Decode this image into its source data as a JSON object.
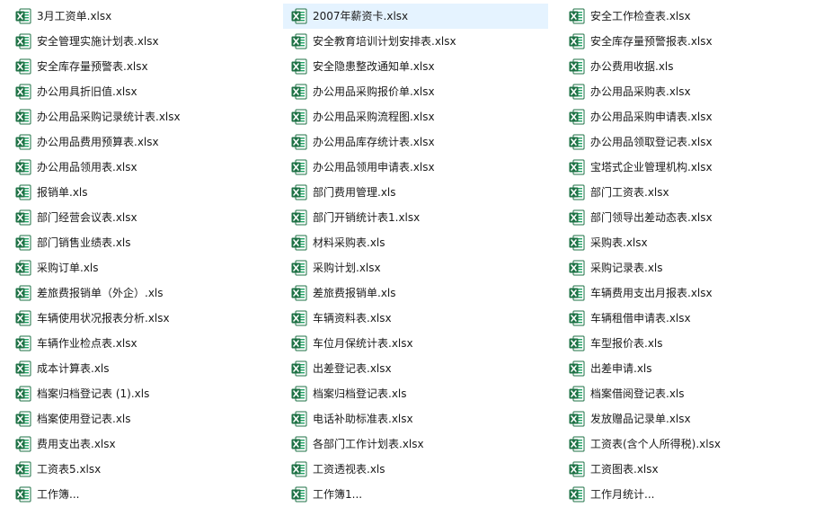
{
  "explorer": {
    "colors": {
      "excel_green": "#1e7145",
      "excel_light": "#21a366",
      "selected_bg": "#e5f3ff"
    },
    "icon": "excel-file-icon",
    "columns": [
      [
        {
          "name": "3月工资单.xlsx"
        },
        {
          "name": "安全管理实施计划表.xlsx"
        },
        {
          "name": "安全库存量预警表.xlsx"
        },
        {
          "name": "办公用具折旧值.xlsx"
        },
        {
          "name": "办公用品采购记录统计表.xlsx"
        },
        {
          "name": "办公用品费用预算表.xlsx"
        },
        {
          "name": "办公用品领用表.xlsx"
        },
        {
          "name": "报销单.xls"
        },
        {
          "name": "部门经营会议表.xlsx"
        },
        {
          "name": "部门销售业绩表.xls"
        },
        {
          "name": "采购订单.xls"
        },
        {
          "name": "差旅费报销单（外企）.xls"
        },
        {
          "name": "车辆使用状况报表分析.xlsx"
        },
        {
          "name": "车辆作业检点表.xlsx"
        },
        {
          "name": "成本计算表.xls"
        },
        {
          "name": "档案归档登记表 (1).xls"
        },
        {
          "name": "档案使用登记表.xls"
        },
        {
          "name": "费用支出表.xlsx"
        },
        {
          "name": "工资表5.xlsx"
        },
        {
          "name": "工作簿..."
        }
      ],
      [
        {
          "name": "2007年薪资卡.xlsx",
          "selected": true
        },
        {
          "name": "安全教育培训计划安排表.xlsx"
        },
        {
          "name": "安全隐患整改通知单.xlsx"
        },
        {
          "name": "办公用品采购报价单.xlsx"
        },
        {
          "name": "办公用品采购流程图.xlsx"
        },
        {
          "name": "办公用品库存统计表.xlsx"
        },
        {
          "name": "办公用品领用申请表.xlsx"
        },
        {
          "name": "部门费用管理.xls"
        },
        {
          "name": "部门开销统计表1.xlsx"
        },
        {
          "name": "材料采购表.xls"
        },
        {
          "name": "采购计划.xlsx"
        },
        {
          "name": "差旅费报销单.xls"
        },
        {
          "name": "车辆资料表.xlsx"
        },
        {
          "name": "车位月保统计表.xlsx"
        },
        {
          "name": "出差登记表.xlsx"
        },
        {
          "name": "档案归档登记表.xls"
        },
        {
          "name": "电话补助标准表.xlsx"
        },
        {
          "name": "各部门工作计划表.xlsx"
        },
        {
          "name": "工资透视表.xls"
        },
        {
          "name": "工作簿1..."
        }
      ],
      [
        {
          "name": "安全工作检查表.xlsx"
        },
        {
          "name": "安全库存量预警报表.xlsx"
        },
        {
          "name": "办公费用收据.xls"
        },
        {
          "name": "办公用品采购表.xlsx"
        },
        {
          "name": "办公用品采购申请表.xlsx"
        },
        {
          "name": "办公用品领取登记表.xlsx"
        },
        {
          "name": "宝塔式企业管理机构.xlsx"
        },
        {
          "name": "部门工资表.xlsx"
        },
        {
          "name": "部门领导出差动态表.xlsx"
        },
        {
          "name": "采购表.xlsx"
        },
        {
          "name": "采购记录表.xls"
        },
        {
          "name": "车辆费用支出月报表.xlsx"
        },
        {
          "name": "车辆租借申请表.xlsx"
        },
        {
          "name": "车型报价表.xls"
        },
        {
          "name": "出差申请.xls"
        },
        {
          "name": "档案借阅登记表.xls"
        },
        {
          "name": "发放赠品记录单.xlsx"
        },
        {
          "name": "工资表(含个人所得税).xlsx"
        },
        {
          "name": "工资图表.xlsx"
        },
        {
          "name": "工作月统计..."
        }
      ]
    ]
  }
}
